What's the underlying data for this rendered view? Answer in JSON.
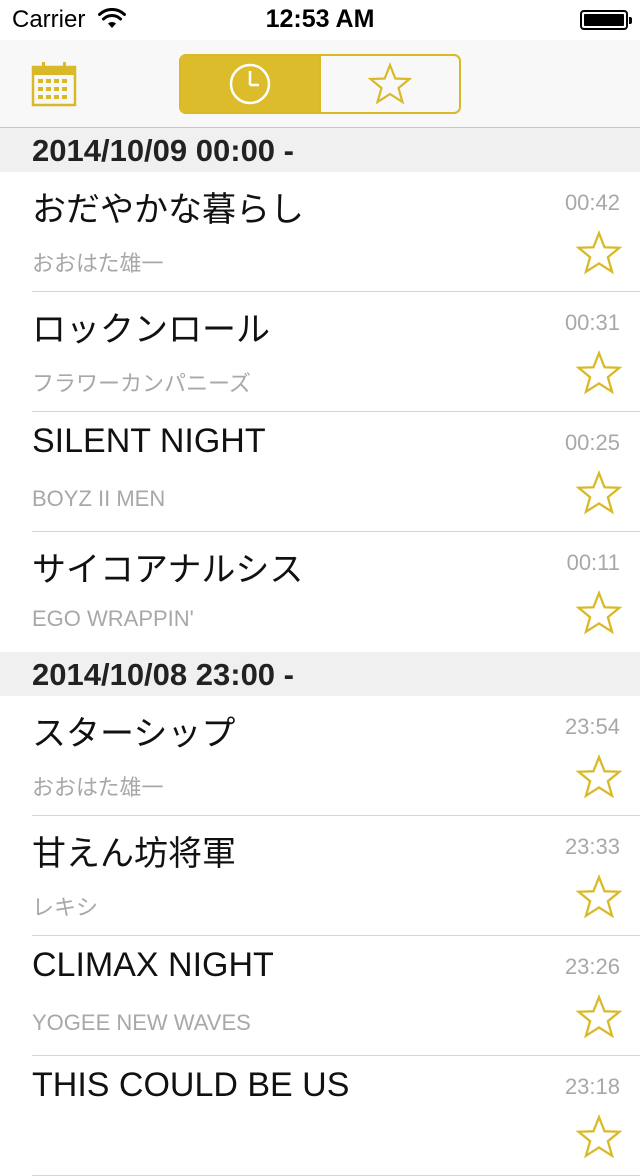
{
  "status_bar": {
    "carrier": "Carrier",
    "time": "12:53 AM"
  },
  "nav": {
    "calendar_icon": "calendar-icon",
    "segments": [
      {
        "icon": "clock-icon",
        "selected": true
      },
      {
        "icon": "star-icon",
        "selected": false
      }
    ]
  },
  "colors": {
    "accent": "#dcbc2a",
    "secondary_text": "#a8a8a8",
    "section_bg": "#f0f0f0"
  },
  "sections": [
    {
      "header": "2014/10/09 00:00 -",
      "items": [
        {
          "title": "おだやかな暮らし",
          "artist": "おおはた雄一",
          "time": "00:42"
        },
        {
          "title": "ロックンロール",
          "artist": "フラワーカンパニーズ",
          "time": "00:31"
        },
        {
          "title": "SILENT NIGHT",
          "artist": "BOYZ II MEN",
          "time": "00:25"
        },
        {
          "title": "サイコアナルシス",
          "artist": "EGO WRAPPIN'",
          "time": "00:11"
        }
      ]
    },
    {
      "header": "2014/10/08 23:00 -",
      "items": [
        {
          "title": "スターシップ",
          "artist": "おおはた雄一",
          "time": "23:54"
        },
        {
          "title": "甘えん坊将軍",
          "artist": "レキシ",
          "time": "23:33"
        },
        {
          "title": "CLIMAX NIGHT",
          "artist": "YOGEE NEW WAVES",
          "time": "23:26"
        },
        {
          "title": "THIS COULD BE US",
          "artist": "",
          "time": "23:18"
        }
      ]
    }
  ]
}
